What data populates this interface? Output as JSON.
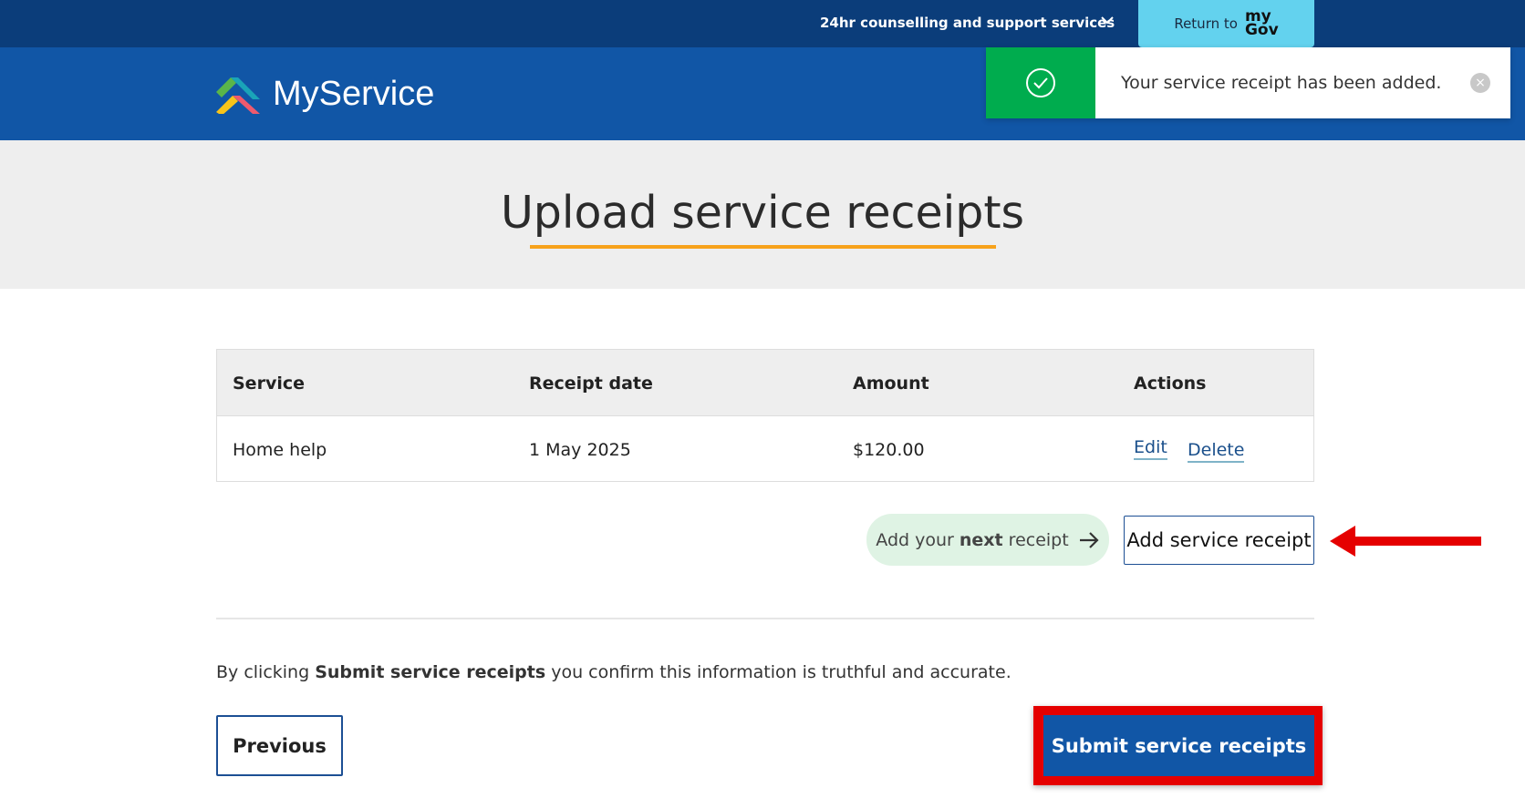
{
  "topbar": {
    "support_label": "24hr counselling and support services",
    "return_label": "Return to",
    "mygov_my": "my",
    "mygov_gov": "Gov"
  },
  "header": {
    "logo_text": "MyService"
  },
  "toast": {
    "message": "Your service receipt has been added.",
    "close": "×"
  },
  "page": {
    "title": "Upload service receipts"
  },
  "table": {
    "headers": [
      "Service",
      "Receipt date",
      "Amount",
      "Actions"
    ],
    "rows": [
      {
        "service": "Home help",
        "date": "1 May 2025",
        "amount": "$120.00",
        "edit": "Edit",
        "delete": "Delete"
      }
    ]
  },
  "actions": {
    "next_prefix": "Add your ",
    "next_bold": "next",
    "next_suffix": " receipt",
    "add_label": "Add service receipt"
  },
  "footer": {
    "confirm_prefix": "By clicking ",
    "confirm_bold": "Submit service receipts",
    "confirm_suffix": " you confirm this information is truthful and accurate.",
    "previous_label": "Previous",
    "submit_label": "Submit service receipts"
  },
  "colors": {
    "topbar": "#0b3d7a",
    "header": "#1156a6",
    "toast_success": "#00ac4e",
    "accent_underline": "#f7a21b",
    "highlight": "#e50000"
  }
}
